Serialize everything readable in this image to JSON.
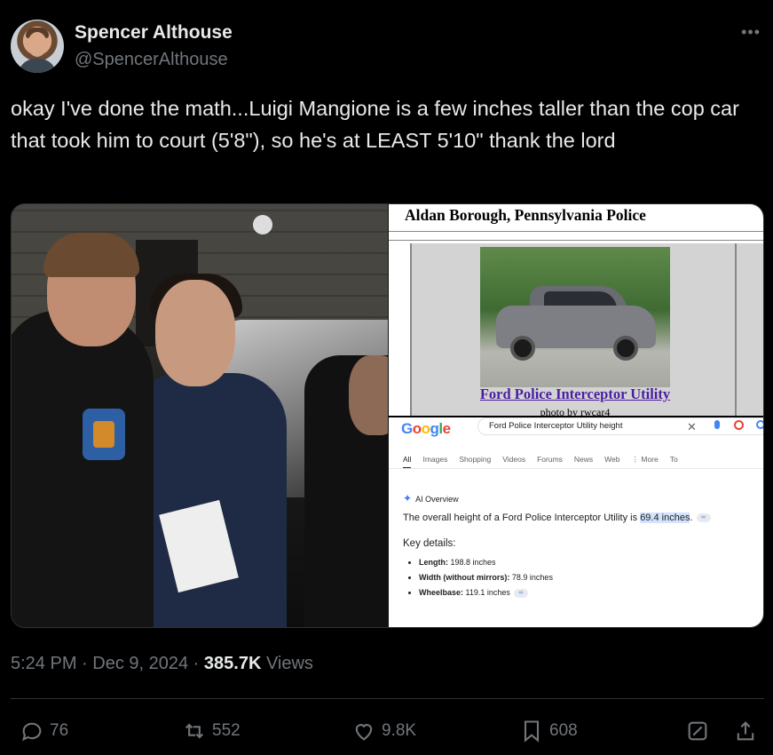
{
  "author": {
    "name": "Spencer Althouse",
    "handle": "@SpencerAlthouse"
  },
  "menu_icon": "more-dots-icon",
  "tweet": {
    "text": "okay I've done the math...Luigi Mangione is a few inches taller than the cop car that took him to court (5'8\"), so he's at LEAST 5'10\" thank the lord"
  },
  "media": {
    "doc": {
      "title": "Aldan Borough, Pennsylvania Police",
      "link": "Ford Police Interceptor Utility",
      "credit": "photo by rwcar4"
    },
    "google": {
      "logo": "Google",
      "query": "Ford Police Interceptor Utility height",
      "tabs": [
        "All",
        "Images",
        "Shopping",
        "Videos",
        "Forums",
        "News",
        "Web",
        "⋮ More",
        "To"
      ],
      "ai_label": "AI Overview",
      "answer_prefix": "The overall height of a Ford Police Interceptor Utility is ",
      "answer_value": "69.4 inches",
      "answer_suffix": ".",
      "key_details_title": "Key details:",
      "details": [
        {
          "label": "Length:",
          "value": " 198.8 inches"
        },
        {
          "label": "Width (without mirrors):",
          "value": " 78.9 inches"
        },
        {
          "label": "Wheelbase:",
          "value": " 119.1 inches"
        }
      ]
    }
  },
  "meta": {
    "time": "5:24 PM · Dec 9, 2024 · ",
    "views_count": "385.7K",
    "views_label": " Views"
  },
  "actions": {
    "replies": "76",
    "reposts": "552",
    "likes": "9.8K",
    "bookmarks": "608"
  },
  "colors": {
    "background": "#000000",
    "text": "#e7e9ea",
    "muted": "#71767b",
    "link_purple": "#4a1ea0"
  }
}
